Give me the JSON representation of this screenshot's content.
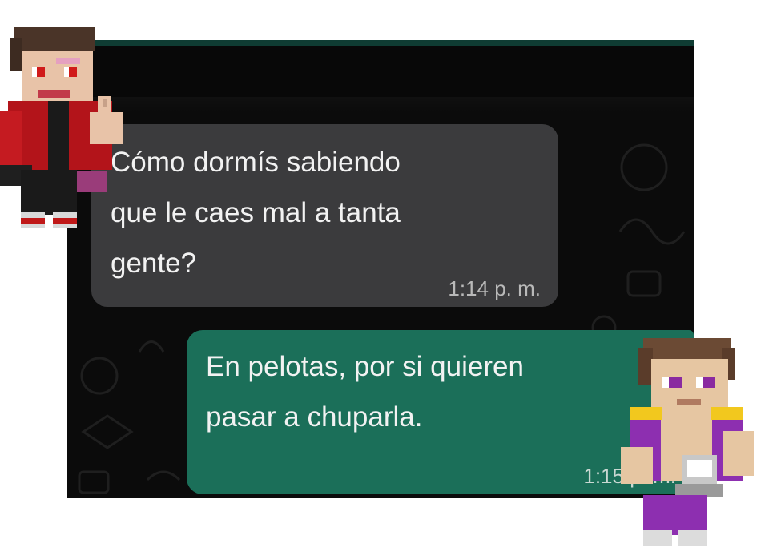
{
  "chat": {
    "messages": [
      {
        "direction": "incoming",
        "text": "Cómo dormís sabiendo\nque le caes mal a tanta\ngente?",
        "time": "1:14 p. m."
      },
      {
        "direction": "outgoing",
        "text": "En pelotas, por si quieren\npasar a chuparla.",
        "time": "1:15 p. m."
      }
    ]
  },
  "colors": {
    "incoming_bubble": "#3b3b3d",
    "outgoing_bubble": "#1b6f59",
    "chat_background": "#0b0b0b"
  },
  "stickers": [
    "minecraft-character-red-hoodie",
    "minecraft-character-purple-outfit"
  ]
}
